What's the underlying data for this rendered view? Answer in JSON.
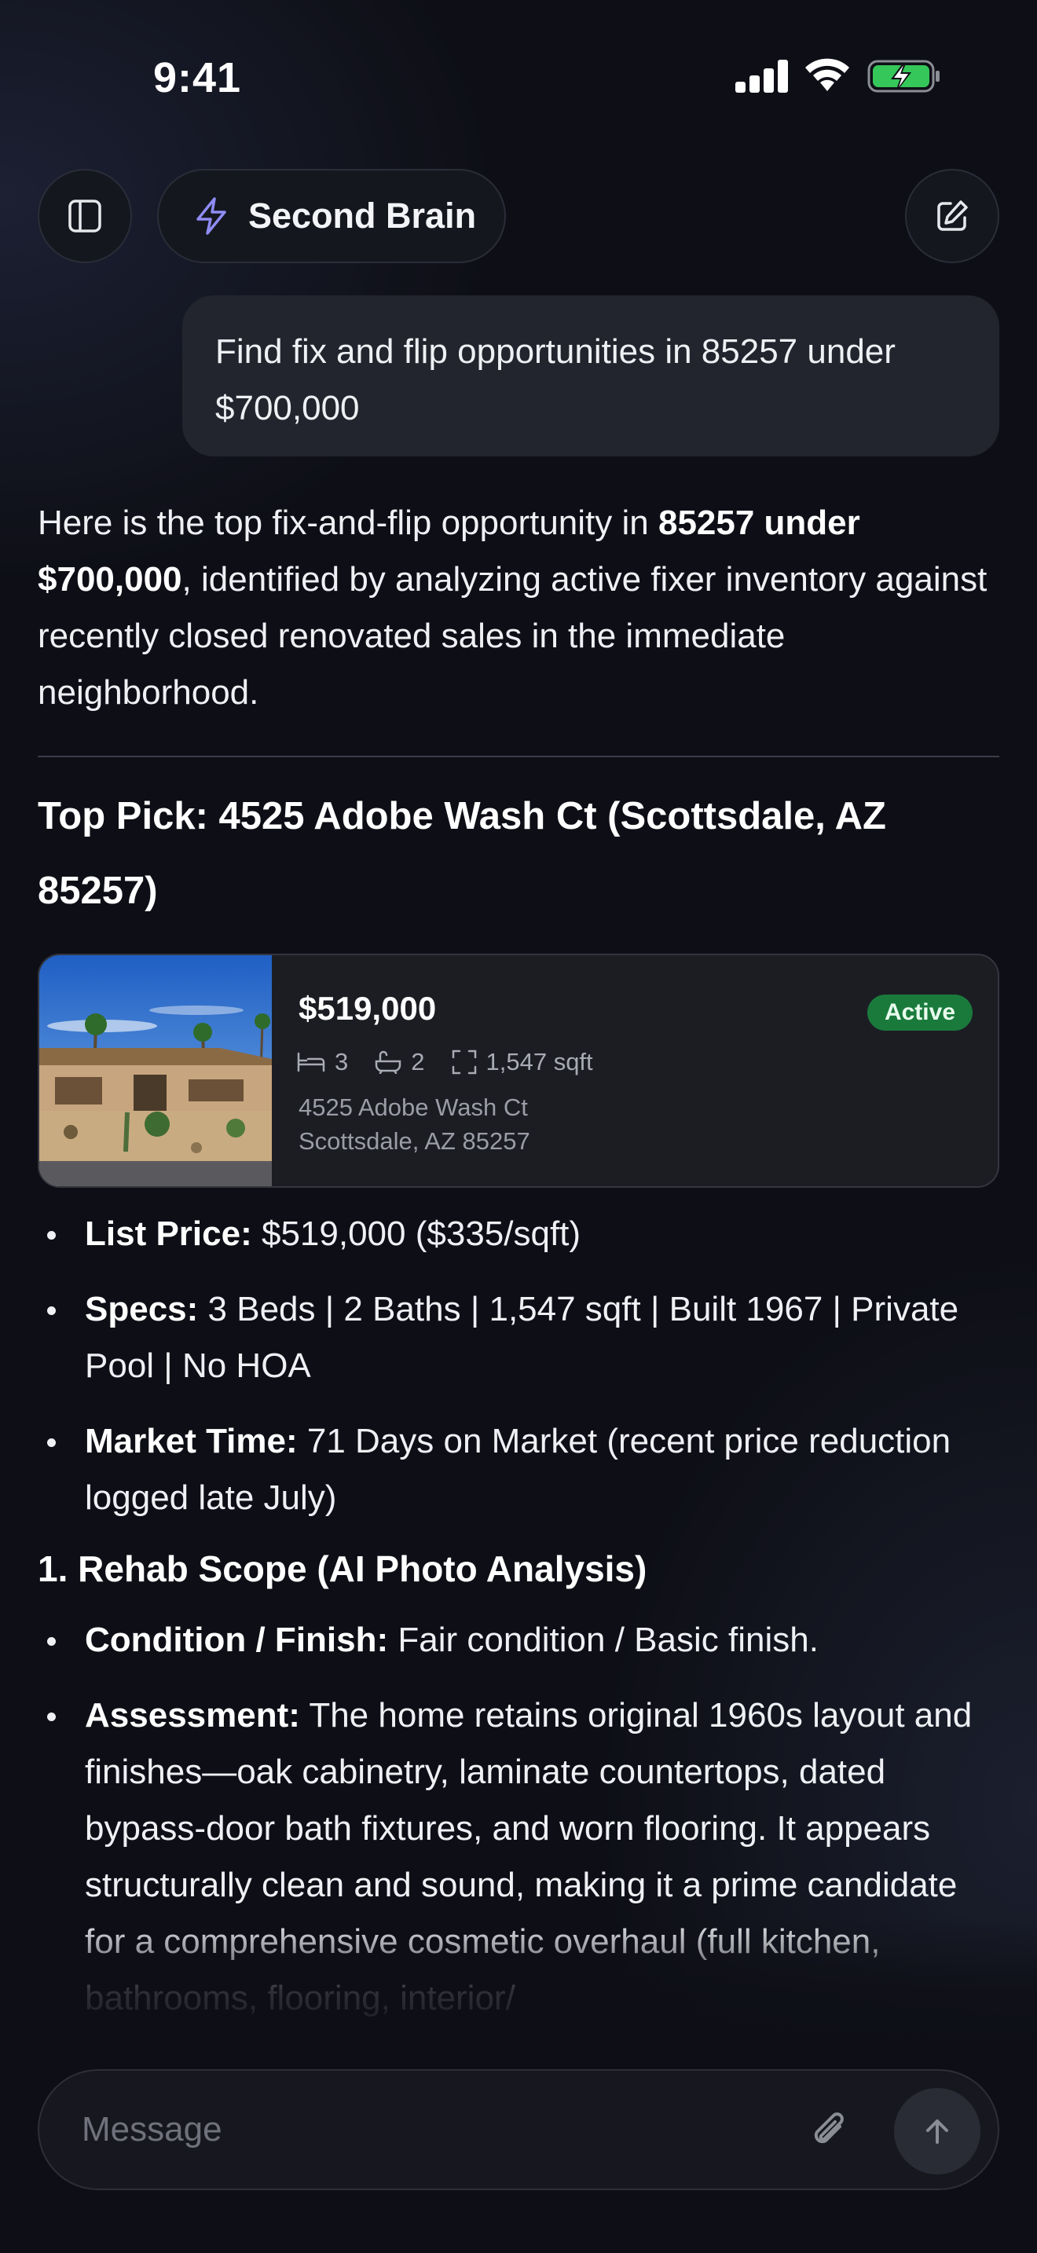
{
  "status_bar": {
    "time": "9:41"
  },
  "header": {
    "brand_label": "Second Brain",
    "icons": {
      "sidebar": "sidebar-toggle-icon",
      "brand": "lightning-icon",
      "new_chat": "compose-icon"
    }
  },
  "conversation": {
    "user_message": "Find fix and flip opportunities in 85257 under $700,000",
    "assistant": {
      "intro_before": "Here is the top fix-and-flip opportunity in ",
      "intro_bold": "85257 under $700,000",
      "intro_after": ", identified by analyzing active fixer inventory against recently closed renovated sales in the immediate neighborhood.",
      "top_pick_heading": "Top Pick: 4525 Adobe Wash Ct (Scottsdale, AZ 85257)",
      "listing_card": {
        "price": "$519,000",
        "status": "Active",
        "beds": "3",
        "baths": "2",
        "sqft": "1,547 sqft",
        "address_line1": "4525 Adobe Wash Ct",
        "address_line2": "Scottsdale, AZ 85257",
        "status_color": "#1a7a3c"
      },
      "details": [
        {
          "label": "List Price:",
          "text": " $519,000 ($335/sqft)"
        },
        {
          "label": "Specs:",
          "text": " 3 Beds | 2 Baths | 1,547 sqft | Built 1967 | Private Pool | No HOA"
        },
        {
          "label": "Market Time:",
          "text": " 71 Days on Market (recent price reduction logged late July)"
        }
      ],
      "section_heading": "1. Rehab Scope (AI Photo Analysis)",
      "rehab": [
        {
          "label": "Condition / Finish:",
          "text": " Fair condition / Basic finish."
        },
        {
          "label": "Assessment:",
          "text": " The home retains original 1960s layout and finishes—oak cabinetry, laminate countertops, dated bypass-door bath fixtures, and worn flooring. It appears structurally clean and sound, making it a prime candidate for a comprehensive cosmetic overhaul (full kitchen, bathrooms, flooring, interior/"
        }
      ]
    }
  },
  "composer": {
    "placeholder": "Message"
  }
}
